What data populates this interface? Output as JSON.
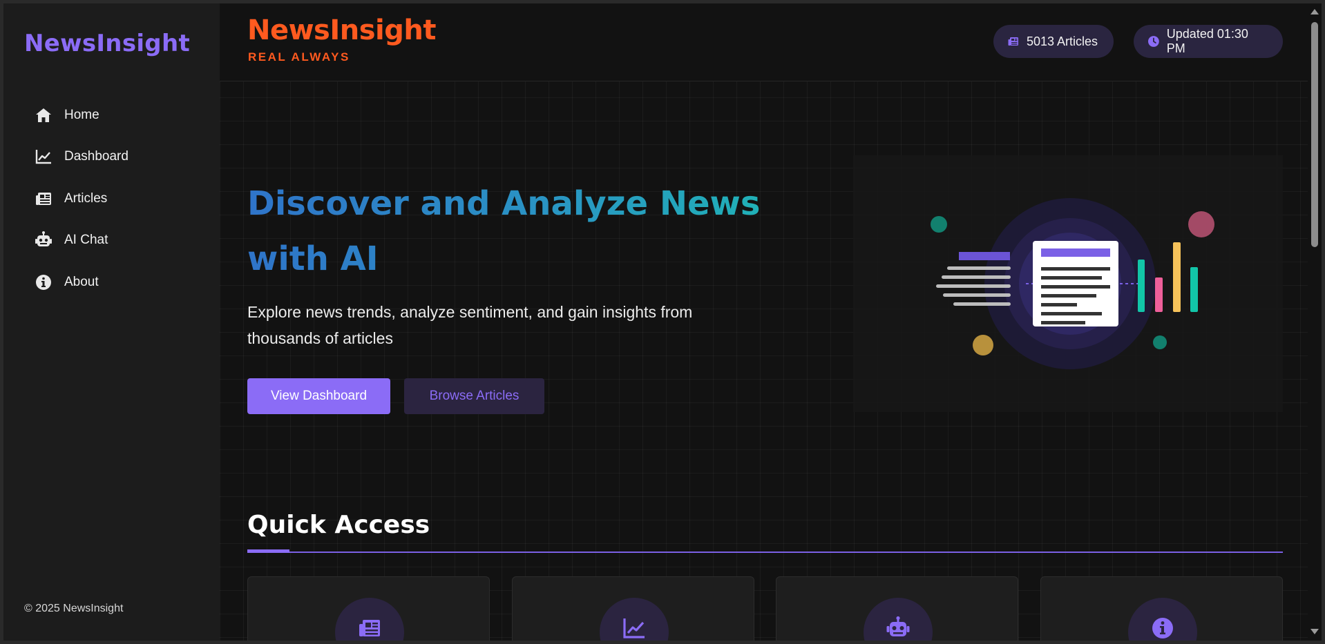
{
  "sidebar": {
    "brand": "NewsInsight",
    "items": [
      {
        "label": "Home",
        "icon": "home-icon"
      },
      {
        "label": "Dashboard",
        "icon": "chart-line-icon"
      },
      {
        "label": "Articles",
        "icon": "newspaper-icon"
      },
      {
        "label": "AI Chat",
        "icon": "robot-icon"
      },
      {
        "label": "About",
        "icon": "info-icon"
      }
    ],
    "copyright": "© 2025 NewsInsight"
  },
  "header": {
    "title": "NewsInsight",
    "tagline": "REAL ALWAYS",
    "articles_count": "5013 Articles",
    "updated": "Updated 01:30 PM"
  },
  "hero": {
    "title_line1": "Discover and Analyze News",
    "title_line2": "with AI",
    "subtitle": "Explore news trends, analyze sentiment, and gain insights from thousands of articles",
    "primary_button": "View Dashboard",
    "secondary_button": "Browse Articles"
  },
  "quick_access": {
    "title": "Quick Access",
    "cards": [
      {
        "icon": "newspaper-icon"
      },
      {
        "icon": "chart-line-icon"
      },
      {
        "icon": "robot-icon"
      },
      {
        "icon": "info-icon"
      }
    ]
  },
  "colors": {
    "accent": "#8b6cf6",
    "brand_orange": "#ff5a1f",
    "sidebar_bg": "#1c1c1c",
    "page_bg": "#121212"
  }
}
